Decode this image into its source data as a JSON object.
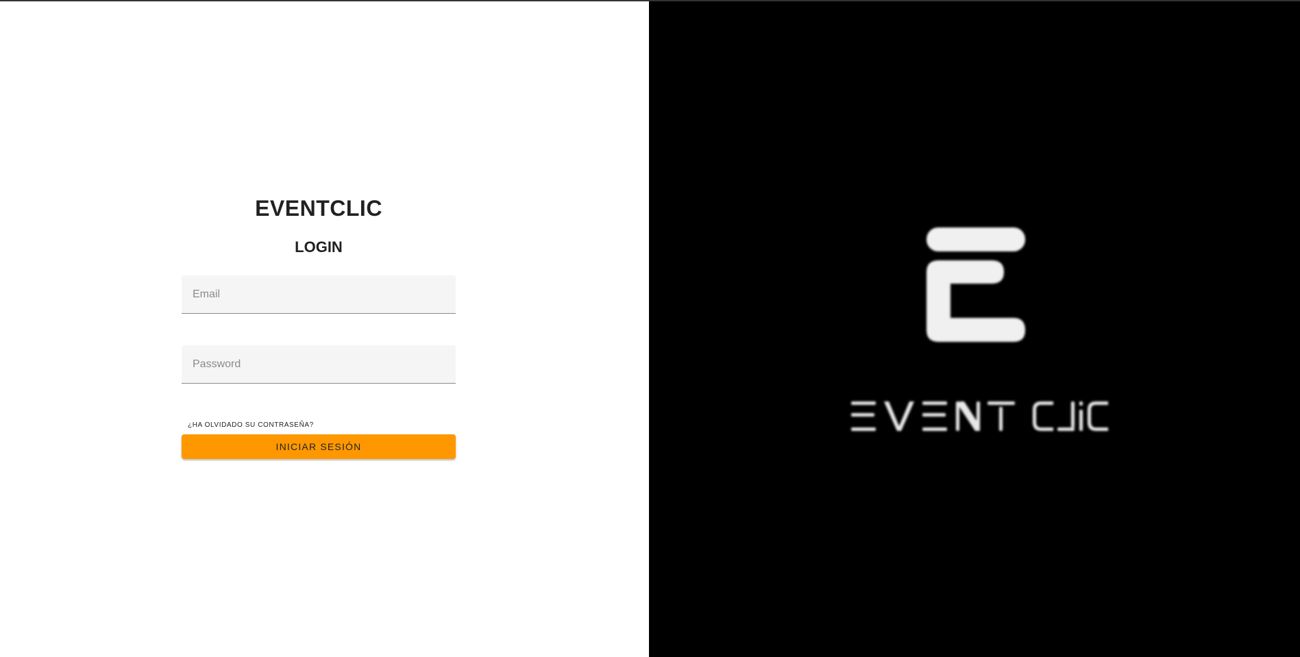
{
  "app": {
    "brand_title": "EVENTCLIC",
    "login_title": "LOGIN"
  },
  "form": {
    "email": {
      "placeholder": "Email",
      "value": ""
    },
    "password": {
      "placeholder": "Password",
      "value": ""
    },
    "forgot_password_label": "¿HA OLVIDADO SU CONTRASEÑA?",
    "submit_label": "INICIAR SESIÓN"
  },
  "logo": {
    "icon_name": "event-clic-e-logo-icon",
    "wordmark": "EVENT CLIC"
  },
  "colors": {
    "accent": "#ff9800",
    "left_background": "#ffffff",
    "right_background": "#000000",
    "logo": "#f0f0f0"
  }
}
